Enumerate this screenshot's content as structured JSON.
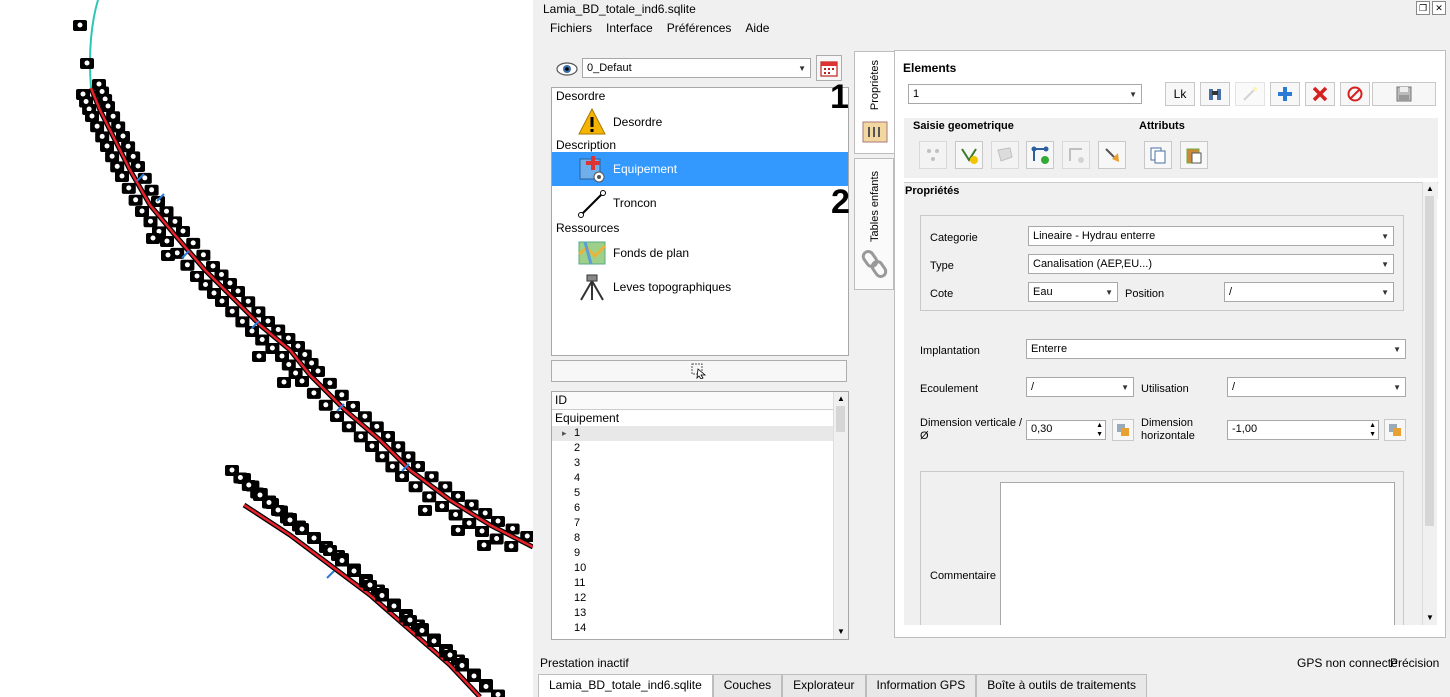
{
  "window": {
    "title": "Lamia_BD_totale_ind6.sqlite"
  },
  "menu": [
    "Fichiers",
    "Interface",
    "Préférences",
    "Aide"
  ],
  "theme_select": {
    "value": "0_Defaut"
  },
  "tree": {
    "groups": [
      {
        "header": "Desordre",
        "items": [
          {
            "label": "Desordre",
            "icon": "warning-icon"
          }
        ]
      },
      {
        "header": "Description",
        "items": [
          {
            "label": "Equipement",
            "icon": "equipment-icon",
            "selected": true
          },
          {
            "label": "Troncon",
            "icon": "pipe-segment-icon"
          }
        ]
      },
      {
        "header": "Ressources",
        "items": [
          {
            "label": "Fonds de plan",
            "icon": "map-icon"
          },
          {
            "label": "Leves topographiques",
            "icon": "tripod-icon"
          }
        ]
      }
    ]
  },
  "idlist": {
    "header": "ID",
    "group": "Equipement",
    "rows": [
      "1",
      "2",
      "3",
      "4",
      "5",
      "6",
      "7",
      "8",
      "9",
      "10",
      "11",
      "12",
      "13",
      "14"
    ]
  },
  "vtabs": [
    {
      "label": "Propriétes",
      "number": "1"
    },
    {
      "label": "Tables enfants",
      "number": "2"
    }
  ],
  "elements": {
    "title": "Elements",
    "value": "1",
    "lk_label": "Lk"
  },
  "saisie": {
    "title": "Saisie geometrique"
  },
  "attributs": {
    "title": "Attributs"
  },
  "proprietes": {
    "title": "Propriétés",
    "categorie_label": "Categorie",
    "categorie_value": "Lineaire - Hydrau enterre",
    "type_label": "Type",
    "type_value": "Canalisation (AEP,EU...)",
    "cote_label": "Cote",
    "cote_value": "Eau",
    "position_label": "Position",
    "position_value": "/",
    "implantation_label": "Implantation",
    "implantation_value": "Enterre",
    "ecoulement_label": "Ecoulement",
    "ecoulement_value": "/",
    "utilisation_label": "Utilisation",
    "utilisation_value": "/",
    "dimv_label_1": "Dimension verticale /",
    "dimv_label_2": "Ø",
    "dimv_value": "0,30",
    "dimh_label_1": "Dimension",
    "dimh_label_2": "horizontale",
    "dimh_value": "-1,00",
    "commentaire_label": "Commentaire"
  },
  "status": {
    "left": "Prestation inactif",
    "gps": "GPS non connecté",
    "precision": "Précision"
  },
  "bottom_tabs": [
    "Lamia_BD_totale_ind6.sqlite",
    "Couches",
    "Explorateur",
    "Information GPS",
    "Boîte à outils de traitements"
  ],
  "colors": {
    "selection": "#3399ff",
    "pipe_red": "#e8202a",
    "pipe_cyan": "#2ec7b4",
    "add_blue": "#2a7bd6",
    "delete_red": "#d62020"
  }
}
